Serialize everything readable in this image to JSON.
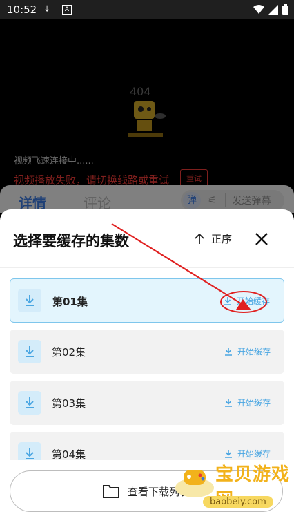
{
  "status_bar": {
    "time": "10:52",
    "a_badge": "A"
  },
  "video": {
    "error_code": "404",
    "connecting_text": "视频飞速连接中......",
    "fail_text": "视频播放失败，请切换线路或重试",
    "retry_label": "重试"
  },
  "tabs": {
    "detail": "详情",
    "comment": "评论",
    "danmu_toggle": "弹",
    "danmu_settings": "⚟",
    "send_danmu": "发送弹幕"
  },
  "sheet": {
    "title": "选择要缓存的集数",
    "sort_label": "正序",
    "episodes": [
      {
        "name": "第01集",
        "action": "开始缓存"
      },
      {
        "name": "第02集",
        "action": "开始缓存"
      },
      {
        "name": "第03集",
        "action": "开始缓存"
      },
      {
        "name": "第04集",
        "action": "开始缓存"
      }
    ],
    "view_downloads_label": "查看下载列表"
  },
  "watermark": {
    "name": "宝贝游戏网",
    "url": "baobeiy.com"
  },
  "colors": {
    "accent": "#4aa6e2",
    "selected_bg": "#e3f5fd",
    "error": "#e53935",
    "annotation": "#e02020"
  }
}
